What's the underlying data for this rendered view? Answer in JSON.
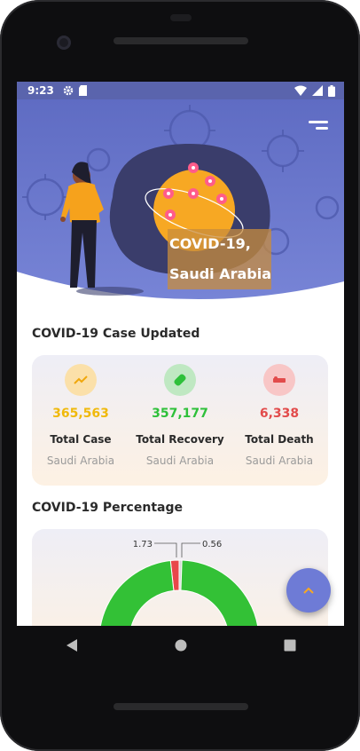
{
  "status_bar": {
    "time": "9:23",
    "icons_left": [
      "gear-icon",
      "sd-card-icon"
    ],
    "icons_right": [
      "wifi-icon",
      "signal-icon",
      "battery-icon"
    ]
  },
  "hero": {
    "title_line1": "COVID-19,",
    "title_line2": "Saudi Arabia",
    "bg_color": "#6b78c9"
  },
  "sections": {
    "cases_title": "COVID-19 Case Updated",
    "percentage_title": "COVID-19 Percentage"
  },
  "stats": [
    {
      "value": "365,563",
      "label": "Total Case",
      "country": "Saudi Arabia",
      "color": "#f0b90b",
      "icon": "trend-up-icon"
    },
    {
      "value": "357,177",
      "label": "Total Recovery",
      "country": "Saudi Arabia",
      "color": "#2ec03a",
      "icon": "bandage-icon"
    },
    {
      "value": "6,338",
      "label": "Total Death",
      "country": "Saudi Arabia",
      "color": "#e24b4b",
      "icon": "bed-icon"
    }
  ],
  "chart_data": {
    "type": "pie",
    "labels": [
      "1.73",
      "0.56"
    ],
    "values": [
      97.71,
      1.73,
      0.56
    ],
    "colors": [
      "#33c136",
      "#e8474a",
      "#d6d6d6"
    ]
  },
  "fab": {
    "icon": "chevron-up-icon"
  },
  "nav": {
    "icons": [
      "back-icon",
      "home-icon",
      "recents-icon"
    ]
  }
}
